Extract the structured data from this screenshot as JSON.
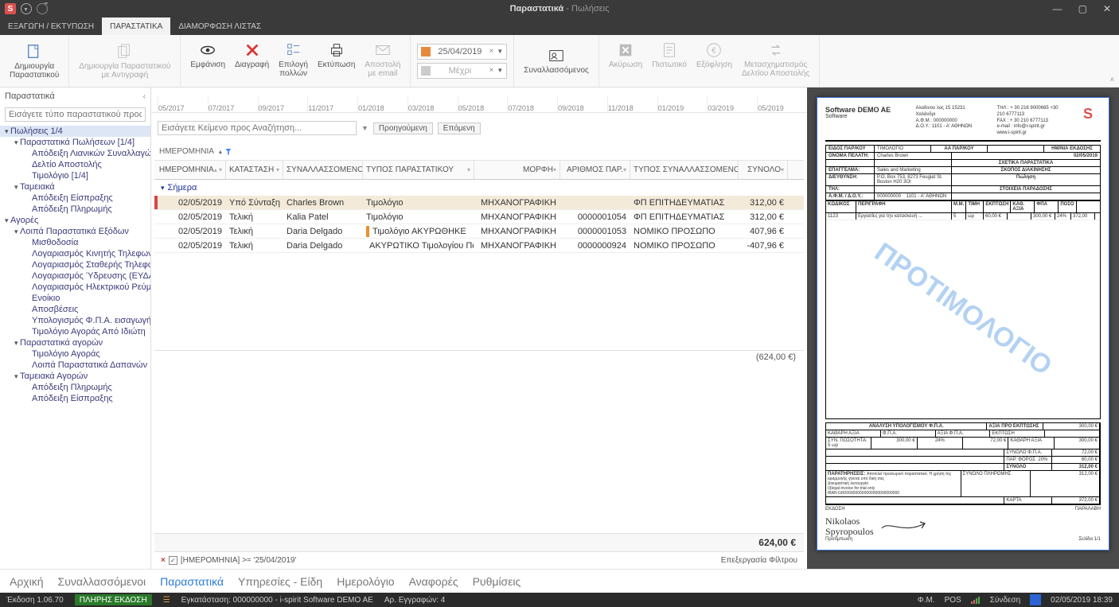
{
  "titlebar": {
    "title_bold": "Παραστατικά",
    "title_light": " - Πωλήσεις"
  },
  "ribbon_tabs": {
    "export_print": "ΕΞΑΓΩΓΗ / ΕΚΤΥΠΩΣΗ",
    "documents": "ΠΑΡΑΣΤΑΤΙΚΑ",
    "list_config": "ΔΙΑΜΟΡΦΩΣΗ ΛΙΣΤΑΣ"
  },
  "ribbon": {
    "create": "Δημιουργία\nΠαραστατικού",
    "create_copy": "Δημιουργία Παραστατικού\nμε Αντιγραφή",
    "view": "Εμφάνιση",
    "delete": "Διαγραφή",
    "multi": "Επιλογή\nπολλών",
    "print": "Εκτύπωση",
    "email": "Αποστολή\nμε email",
    "date_from": "25/04/2019",
    "date_to": "Μέχρι",
    "party": "Συναλλασσόμενος",
    "cancel": "Ακύρωση",
    "credit": "Πιστωτικό",
    "pay": "Εξόφληση",
    "transform": "Μετασχηματισμός\nΔελτίου Αποστολής"
  },
  "sidebar": {
    "title": "Παραστατικά",
    "search_placeholder": "Εισάγετε τύπο παραστατικού προς αναζήτηση",
    "root_sales": "Πωλήσεις 1/4",
    "sales_docs": "Παραστατικά Πωλήσεων [1/4]",
    "retail": "Απόδειξη Λιανικών Συναλλαγών",
    "dispatch": "Δελτίο Αποστολής",
    "invoice_count": "Τιμολόγιο [1/4]",
    "cash": "Ταμειακά",
    "receipt": "Απόδειξη Είσπραξης",
    "payment": "Απόδειξη Πληρωμής",
    "purchases": "Αγορές",
    "other_exp": "Λοιπά Παραστατικά Εξόδων",
    "payroll": "Μισθοδοσία",
    "mobile": "Λογαριασμός Κινητής Τηλεφωνίας",
    "land": "Λογαριασμός Σταθερής Τηλεφωνίας",
    "water": "Λογαριασμός Ύδρευσης (ΕΥΔΑΠ κοκ)",
    "elec": "Λογαριασμός Ηλεκτρικού Ρεύματος",
    "rent": "Ενοίκιο",
    "depr": "Αποσβέσεις",
    "vat_imp": "Υπολογισμός Φ.Π.Α. εισαγωγής",
    "priv_inv": "Τιμολόγιο Αγοράς Από Ιδιώτη",
    "purch_docs": "Παραστατικά αγορών",
    "purch_inv": "Τιμολόγιο Αγοράς",
    "other_purch": "Λοιπά Παραστατικά Δαπανών",
    "purch_cash": "Ταμειακά Αγορών",
    "pay2": "Απόδειξη Πληρωμής",
    "rec2": "Απόδειξη Είσπραξης"
  },
  "timeline": [
    "05/2017",
    "07/2017",
    "09/2017",
    "11/2017",
    "01/2018",
    "03/2018",
    "05/2018",
    "07/2018",
    "09/2018",
    "11/2018",
    "01/2019",
    "03/2019",
    "05/2019"
  ],
  "search": {
    "placeholder": "Εισάγετε Κείμενο προς Αναζήτηση...",
    "prev": "Προηγούμενη",
    "next": "Επόμενη"
  },
  "grid": {
    "group_by": "ΗΜΕΡΟΜΗΝΙΑ",
    "cols": {
      "date": "ΗΜΕΡΟΜΗΝΙΑ",
      "status": "ΚΑΤΑΣΤΑΣΗ",
      "party": "ΣΥΝΑΛΛΑΣΣΟΜΕΝΟΣ",
      "doc": "ΤΥΠΟΣ ΠΑΡΑΣΤΑΤΙΚΟΥ",
      "form": "ΜΟΡΦΗ",
      "num": "ΑΡΙΘΜΟΣ ΠΑΡ.",
      "ptype": "ΤΥΠΟΣ ΣΥΝΑΛΛΑΣΣΟΜΕΝΟΥ",
      "total": "ΣΥΝΟΛΟ"
    },
    "group_label": "Σήμερα",
    "rows": [
      {
        "mark": "red",
        "date": "02/05/2019",
        "status": "Υπό Σύνταξη",
        "party": "Charles Brown",
        "strip": "",
        "doc": "Τιμολόγιο",
        "form": "ΜΗΧΑΝΟΓΡΑΦΙΚΗ",
        "num": "",
        "ptype": "ΦΠ ΕΠΙΤΗΔΕΥΜΑΤΙΑΣ",
        "total": "312,00 €",
        "sel": true
      },
      {
        "mark": "",
        "date": "02/05/2019",
        "status": "Τελική",
        "party": "Kalia Patel",
        "strip": "",
        "doc": "Τιμολόγιο",
        "form": "ΜΗΧΑΝΟΓΡΑΦΙΚΗ",
        "num": "0000001054",
        "ptype": "ΦΠ ΕΠΙΤΗΔΕΥΜΑΤΙΑΣ",
        "total": "312,00 €"
      },
      {
        "mark": "",
        "date": "02/05/2019",
        "status": "Τελική",
        "party": "Daria Delgado",
        "strip": "orange",
        "doc": "Τιμολόγιο ΑΚΥΡΩΘΗΚΕ",
        "form": "ΜΗΧΑΝΟΓΡΑΦΙΚΗ",
        "num": "0000001053",
        "ptype": "ΝΟΜΙΚΟ ΠΡΟΣΩΠΟ",
        "total": "407,96 €"
      },
      {
        "mark": "",
        "date": "02/05/2019",
        "status": "Τελική",
        "party": "Daria Delgado",
        "strip": "green",
        "doc": "ΑΚΥΡΩΤΙΚΟ Τιμολογίου Πώλησης",
        "form": "ΜΗΧΑΝΟΓΡΑΦΙΚΗ",
        "num": "0000000924",
        "ptype": "ΝΟΜΙΚΟ ΠΡΟΣΩΠΟ",
        "total": "-407,96 €"
      }
    ],
    "subtotal": "(624,00 €)",
    "grandtotal": "624,00 €",
    "filter_text": "[ΗΜΕΡΟΜΗΝΙΑ] >= '25/04/2019'",
    "filter_edit": "Επεξεργασία Φίλτρου"
  },
  "preview": {
    "company": "Software DEMO AE",
    "subcompany": "Software",
    "addr1": "Αλαδινου λος 15 15231",
    "addr2": "Χαλάνδρι",
    "tel1": "ΤΗΛ : + 30 216 9000665 +30",
    "tel2": "210 6777113",
    "fax": "FAX : + 30 210 6777113",
    "afm": "Α.Φ.Μ.: 000000000",
    "doy": "Δ.Ο.Υ.: 1101 - Α' ΑΘΗΝΩΝ",
    "mail": "e-mail : info@i-spirit.gr",
    "site": "www.i-spirit.gr",
    "f_kind": "ΕΙΔΟΣ ΠΑΡ/ΚΟΥ",
    "v_kind": "ΤΙΜΟΛΟΓΙΟ",
    "f_aa": "ΑΑ ΠΑΡ/ΚΟΥ",
    "f_date": "ΗΜ/ΝΙΑ ΕΚΔΟΣΗΣ",
    "v_date": "02/05/2019",
    "f_name": "ΟΝΟΜΑ ΠΕΛΑΤΗ:",
    "v_name": "Charles Brown",
    "f_rel": "ΣΧΕΤΙΚΑ ΠΑΡΑΣΤΑΤΙΚΑ",
    "f_job": "ΕΠΑΓΓΕΛΜΑ:",
    "v_job": "Sales and Marketing",
    "f_purpose": "ΣΚΟΠΟΣ ΔΙΑΚΙΝΗΣΗΣ",
    "v_purpose": "Πώληση",
    "f_addr": "ΔΙΕΥΘΥΝΣΗ:",
    "v_addr": "P.O. Box 753, 8273 Feugiat St.\nBoston H20 3OI",
    "f_ship": "ΣΤΟΙΧΕΙΑ ΠΑΡΑΔΟΣΗΣ",
    "f_tel": "ΤΗΛ:",
    "f_afm": "Α.Φ.Μ. / Δ.Ο.Υ.:",
    "v_afm": "000000000",
    "v_doy": "1101 - Α' ΑΘΗΝΩΝ",
    "th": [
      "ΚΩΔΙΚΟΣ",
      "ΠΕΡΙΓΡΑΦΗ",
      "Μ.Μ.",
      "ΤΙΜΗ",
      "ΕΚΠΤΩΣΗ",
      "ΚΑΘ. ΑΞΙΑ",
      "ΦΠΑ",
      "ΠΟΣΟ"
    ],
    "row": [
      "1123",
      "Εργασίες για την κατασκευή ...",
      "5",
      "ωρ",
      "60,00 €",
      "",
      "300,00 €",
      "24%",
      "372,00"
    ],
    "watermark": "ΠΡΟΤΙΜΟΛΟΓΙΟ",
    "tot_analysis": "ΑΝΑΛΥΣΗ ΥΠΟΛΟΓΙΣΜΟΥ Φ.Π.Α.",
    "tot_before": "ΑΞΙΑ ΠΡΟ ΕΚΠΤΩΣΗΣ",
    "tot_before_v": "300,00 €",
    "tot_net": "ΚΑΘΑΡΗ ΑΞΙΑ",
    "tot_vat": "Φ.Π.Α.",
    "tot_vatval": "ΑΞΙΑ Φ.Π.Α.",
    "tot_disc": "ΕΚΠΤΩΣΗ",
    "l_net": "300,00 €",
    "l_vat": "24%",
    "l_vatval": "72,00 €",
    "tot_qty": "ΣΥΝ. ΠΟΣΟΤΗΤΑ: 5 ωρ",
    "r_net_l": "ΚΑΘΑΡΗ ΑΞΙΑ",
    "r_net_v": "300,00 €",
    "r_vat_l": "ΣΥΝΟΛΟ Φ.Π.Α.",
    "r_vat_v": "72,00 €",
    "r_tax_l": "ΠΑΡ. ΦΟΡΟΣ",
    "r_tax_p": "20%",
    "r_tax_v": "60,00 €",
    "r_total_l": "ΣΥΝΟΛΟ",
    "r_total_v": "312,00 €",
    "r_pay_l": "ΣΥΝΟΛΟ ΠΛΗΡΩΜΗΣ",
    "r_pay_v": "312,00 €",
    "r_card_l": "ΚΑΡΤΑ",
    "r_card_v": "372,00 €",
    "notes_l": "ΠΑΡΑΤΗΡΗΣΕΙΣ:",
    "notes": "Αποτελεί προσωρινό παραστατικό. Η χρήση της εφαρμογής γίνεται υπό δική σας\nΔοκιμαστική λειτουργία\n(i)legal invoice for trial only\nIBAN:GR0000000000000000000000000",
    "issue": "ΕΚΔΟΣΗ",
    "receipt": "ΠΑΡΑΛΑΒΗ",
    "sig_name": "Nikolaos\nSpyropoulos",
    "protimo": "Προτίμπωση",
    "page": "Σελίδα 1/1"
  },
  "mainnav": {
    "home": "Αρχική",
    "parties": "Συναλλασσόμενοι",
    "docs": "Παραστατικά",
    "services": "Υπηρεσίες - Είδη",
    "cal": "Ημερολόγιο",
    "rep": "Αναφορές",
    "set": "Ρυθμίσεις"
  },
  "status": {
    "ver": "Έκδοση 1.06.70",
    "edition": "ΠΛΗΡΗΣ ΕΚΔΟΣΗ",
    "install": "Εγκατάσταση: 000000000 - i-spirit Software DEMO AE",
    "rec": "Αρ. Εγγραφών: 4",
    "fm": "Φ.Μ.",
    "pos": "POS",
    "conn": "Σύνδεση",
    "dt": "02/05/2019 18:39"
  }
}
